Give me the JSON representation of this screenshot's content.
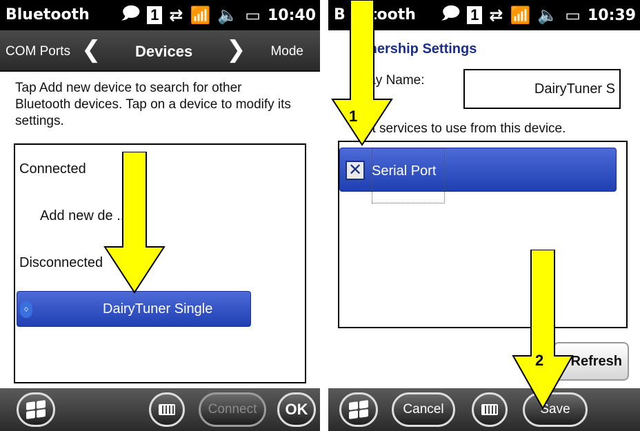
{
  "left_screen": {
    "status_bar": {
      "title": "Bluetooth",
      "indicator_number": "1",
      "time": "10:40"
    },
    "nav": {
      "left": "COM Ports",
      "center": "Devices",
      "right": "Mode"
    },
    "instructions": "Tap Add new device to search for other Bluetooth devices. Tap on a device to modify its settings.",
    "list": {
      "connected_label": "Connected",
      "add_device_label": "Add new de    ...",
      "disconnected_label": "Disconnected",
      "device_name": "DairyTuner Single"
    },
    "softkeys": {
      "connect": "Connect",
      "ok": "OK"
    }
  },
  "right_screen": {
    "status_bar": {
      "title_left": "B",
      "title_right": "tooth",
      "indicator_number": "1",
      "time": "10:39"
    },
    "heading": "tnership Settings",
    "display_label": "lay Name:",
    "display_value": "DairyTuner S",
    "services_label": "ct services to use from this device.",
    "service_name": "Serial Port",
    "refresh": "Refresh",
    "softkeys": {
      "cancel": "Cancel",
      "save": "Save"
    }
  },
  "annotations": {
    "step1": "1",
    "step2": "2",
    "arrow_color": "#ffff00"
  },
  "colors": {
    "selection_blue": "#2a48c4",
    "heading_blue": "#1a2f8c"
  }
}
